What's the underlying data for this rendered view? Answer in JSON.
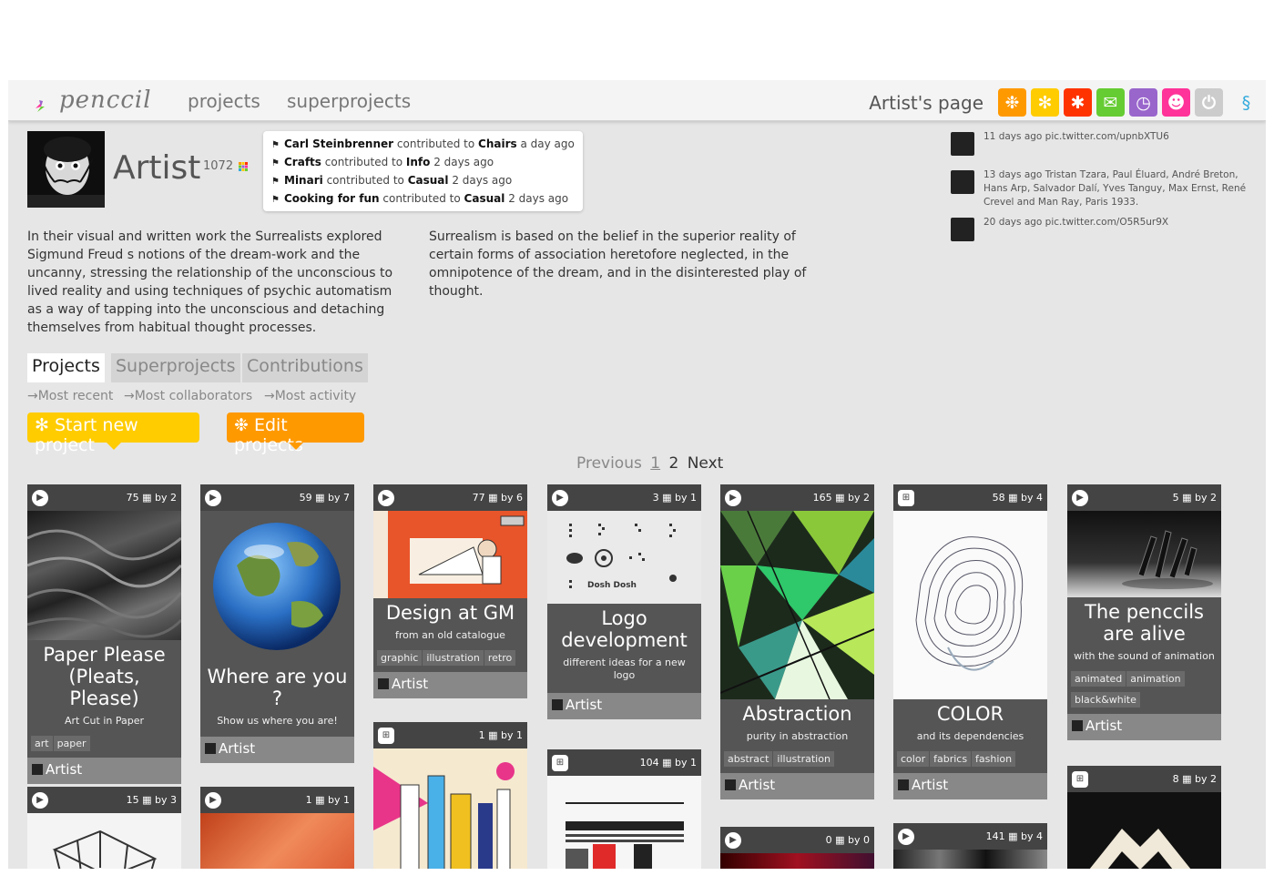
{
  "header": {
    "logo_text": "penccil",
    "nav": [
      "projects",
      "superprojects"
    ],
    "artist_page_label": "Artist's page",
    "buttons": [
      {
        "name": "snowflake-orange",
        "color": "#ff9900",
        "glyph": "❉"
      },
      {
        "name": "snowflake-yellow",
        "color": "#ffcc00",
        "glyph": "✻"
      },
      {
        "name": "snowflake-red",
        "color": "#ff3300",
        "glyph": "✱"
      },
      {
        "name": "mail",
        "color": "#66cc33",
        "glyph": "✉"
      },
      {
        "name": "clock",
        "color": "#9966cc",
        "glyph": "◷"
      },
      {
        "name": "user",
        "color": "#ff3399",
        "glyph": "☻"
      },
      {
        "name": "power",
        "color": "#cccccc",
        "glyph": "⏻"
      },
      {
        "name": "help",
        "color": "#f4f4f4",
        "glyph": "§"
      }
    ]
  },
  "profile": {
    "name": "Artist",
    "score": "1072"
  },
  "activity": [
    {
      "who": "Carl Steinbrenner",
      "verb": "contributed to",
      "what": "Chairs",
      "when": "a day ago"
    },
    {
      "who": "Crafts",
      "verb": "contributed to",
      "what": "Info",
      "when": "2 days ago"
    },
    {
      "who": "Minari",
      "verb": "contributed to",
      "what": "Casual",
      "when": "2 days ago"
    },
    {
      "who": "Cooking for fun",
      "verb": "contributed to",
      "what": "Casual",
      "when": "2 days ago"
    }
  ],
  "tweets": [
    {
      "text": "11 days ago pic.twitter.com/upnbXTU6"
    },
    {
      "text": "13 days ago Tristan Tzara, Paul Éluard, André Breton, Hans Arp, Salvador Dalí, Yves Tanguy, Max Ernst, René Crevel and Man Ray, Paris 1933."
    },
    {
      "text": "20 days ago pic.twitter.com/O5R5ur9X"
    }
  ],
  "bio": {
    "left": "In their visual and written work the Surrealists explored Sigmund Freud s notions of the dream-work and the uncanny, stressing the relationship of the unconscious to lived reality and using techniques of psychic automatism as a way of tapping into the unconscious and detaching themselves from habitual thought processes.",
    "right": "Surrealism is based on the belief in the superior reality of certain forms of association heretofore neglected, in the omnipotence of the dream, and in the disinterested play of thought."
  },
  "tabs": [
    "Projects",
    "Superprojects",
    "Contributions"
  ],
  "sort_links": [
    "→Most recent",
    "→Most collaborators",
    "→Most activity"
  ],
  "actions": {
    "start_label": "✻ Start new project",
    "edit_label": "❉ Edit projects",
    "start_color": "#ffcc00",
    "edit_color": "#ff9900"
  },
  "pager": {
    "prev": "Previous",
    "p1": "1",
    "p2": "2",
    "next": "Next"
  },
  "cards": [
    {
      "count": "75",
      "by": "by 2",
      "title": "Paper Please (Pleats, Please)",
      "sub": "Art Cut in Paper",
      "tags": [
        "art",
        "paper"
      ],
      "author": "Artist"
    },
    {
      "count": "59",
      "by": "by 7",
      "title": "Where are you ?",
      "sub": "Show us where you are!",
      "tags": [],
      "author": "Artist"
    },
    {
      "count": "77",
      "by": "by 6",
      "title": "Design at GM",
      "sub": "from an old catalogue",
      "tags": [
        "graphic",
        "illustration",
        "retro"
      ],
      "author": "Artist"
    },
    {
      "count": "3",
      "by": "by 1",
      "title": "Logo development",
      "sub": "different ideas for a new logo",
      "tags": [],
      "author": "Artist"
    },
    {
      "count": "165",
      "by": "by 2",
      "title": "Abstraction",
      "sub": "purity in abstraction",
      "tags": [
        "abstract",
        "illustration"
      ],
      "author": "Artist"
    },
    {
      "count": "58",
      "by": "by 4",
      "title": "COLOR",
      "sub": "and its dependencies",
      "tags": [
        "color",
        "fabrics",
        "fashion"
      ],
      "author": "Artist"
    },
    {
      "count": "5",
      "by": "by 2",
      "title": "The penccils are alive",
      "sub": "with the sound of animation",
      "tags": [
        "animated",
        "animation",
        "black&white"
      ],
      "author": "Artist"
    },
    {
      "count": "15",
      "by": "by 3"
    },
    {
      "count": "1",
      "by": "by 1"
    },
    {
      "count": "1",
      "by": "by 1"
    },
    {
      "count": "104",
      "by": "by 1"
    },
    {
      "count": "0",
      "by": "by 0"
    },
    {
      "count": "141",
      "by": "by 4"
    },
    {
      "count": "8",
      "by": "by 2"
    }
  ]
}
